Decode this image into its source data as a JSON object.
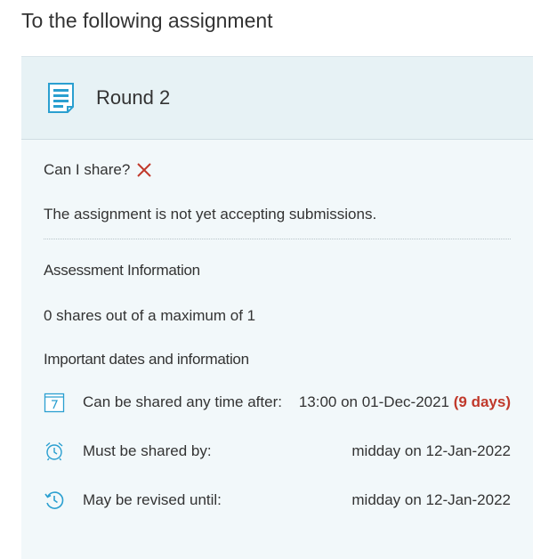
{
  "heading": "To the following assignment",
  "card": {
    "title": "Round 2",
    "share_question": "Can I share?",
    "status": "The assignment is not yet accepting submissions.",
    "assessment_label": "Assessment Information",
    "shares_text": "0 shares out of a maximum of 1",
    "dates_label": "Important dates and information",
    "dates": [
      {
        "icon": "calendar-icon",
        "label": "Can be shared any time after:",
        "value": "13:00 on 01-Dec-2021",
        "extra": "(9 days)"
      },
      {
        "icon": "alarm-clock-icon",
        "label": "Must be shared by:",
        "value": "midday on 12-Jan-2022"
      },
      {
        "icon": "history-clock-icon",
        "label": "May be revised until:",
        "value": "midday on 12-Jan-2022"
      }
    ]
  },
  "colors": {
    "accent_icon": "#2a9fd0",
    "cross": "#c0392b",
    "highlight_days": "#c0392b",
    "card_background": "#f2f8fa",
    "header_background": "#e7f2f5"
  }
}
